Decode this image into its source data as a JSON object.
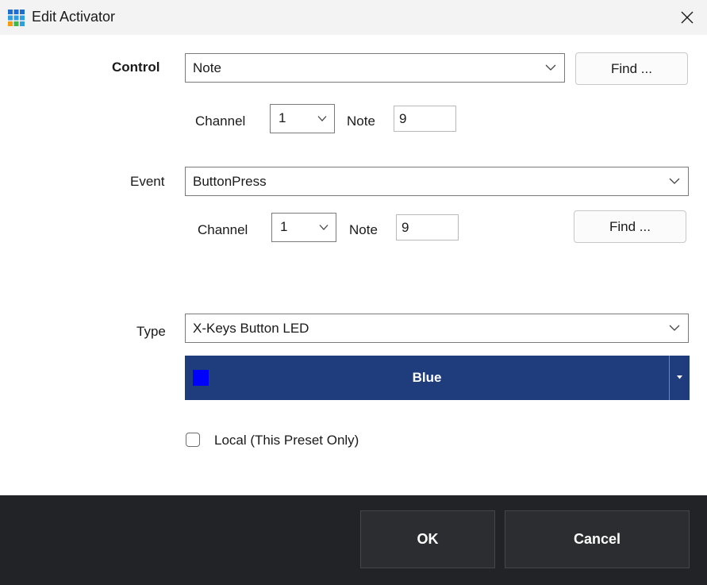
{
  "window": {
    "title": "Edit Activator",
    "close_glyph": "✕"
  },
  "control": {
    "label": "Control",
    "value": "Note",
    "find_label": "Find ...",
    "channel_label": "Channel",
    "channel_value": "1",
    "note_label": "Note",
    "note_value": "9"
  },
  "event": {
    "label": "Event",
    "value": "ButtonPress",
    "channel_label": "Channel",
    "channel_value": "1",
    "note_label": "Note",
    "note_value": "9",
    "find_label": "Find ..."
  },
  "type": {
    "label": "Type",
    "value": "X-Keys Button LED"
  },
  "color": {
    "name": "Blue",
    "swatch": "#0000ff",
    "background": "#1f3c7c"
  },
  "local": {
    "label": "Local (This Preset Only)",
    "checked": false
  },
  "footer": {
    "ok_label": "OK",
    "cancel_label": "Cancel"
  },
  "icons": {
    "app": "grid-icon",
    "close": "close-icon",
    "dropdown": "chevron-down-icon",
    "color_dropdown": "caret-down-icon"
  }
}
